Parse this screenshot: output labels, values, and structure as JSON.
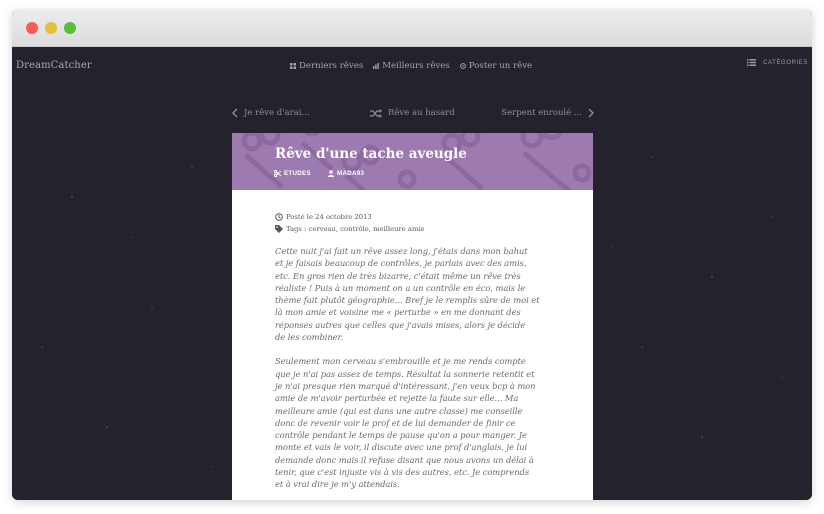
{
  "site": {
    "logo": "DreamCatcher"
  },
  "nav": {
    "items": [
      {
        "label": "Derniers rêves",
        "icon": "grid-icon"
      },
      {
        "label": "Meilleurs rêves",
        "icon": "bar-chart-icon"
      },
      {
        "label": "Poster un rêve",
        "icon": "plus-circle-icon"
      }
    ],
    "categories_label": "CATÉGORIES",
    "categories_icon": "list-icon"
  },
  "pager": {
    "prev_label": "Je rêve d'arai...",
    "random_label": "Rêve au hasard",
    "next_label": "Serpent enroulé ..."
  },
  "dream": {
    "title": "Rêve d'une tache aveugle",
    "category": "ETUDES",
    "author": "MADA93",
    "posted": "Posté le 24 octobre 2013",
    "tags": "Tags : cerveau, contrôle, meilleure amie",
    "header_color": "#9d7bb0",
    "paragraph1_lines": [
      "Cette nuit j'ai fait un rêve assez long, j'étais dans mon bahut",
      "et je faisais beaucoup de contrôles, je parlais avec des amis,",
      "etc. En gros rien de très bizarre, c'était même un rêve très",
      "réaliste ! Puis à un moment on a un contrôle en éco, mais le",
      "thème fait plutôt géographie... Bref je le remplis sûre de moi et",
      "là mon amie et voisine me « perturbe » en me donnant des",
      "réponses autres que celles que j'avais mises, alors je décide",
      "de les combiner."
    ],
    "paragraph2_lines": [
      "Seulement mon cerveau s'embrouille et je me rends compte",
      "que je n'ai pas assez de temps. Résultat la sonnerie retentit et",
      "je n'ai presque rien marqué d'intéressant, j'en veux bcp à mon",
      "amie de m'avoir perturbée et rejette la faute sur elle... Ma",
      "meilleure amie (qui est dans une autre classe) me conseille",
      "donc de revenir voir le prof et de lui demander de finir ce",
      "contrôle pendant le temps de pause qu'on a pour manger. Je",
      "monte et vais le voir, il discute avec une prof d'anglais, je lui",
      "demande donc mais il refuse disant que nous avons un délai à",
      "tenir, que c'est injuste vis à vis des autres, etc. Je comprends",
      "et à vrai dire je m'y attendais."
    ]
  }
}
